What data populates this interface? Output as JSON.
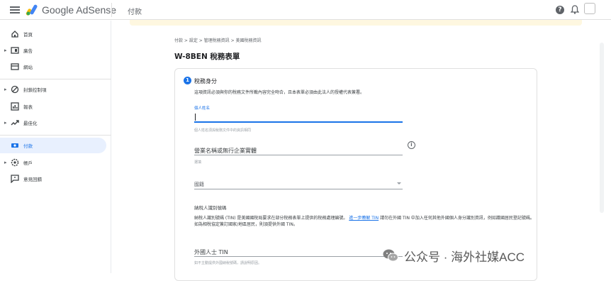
{
  "topbar": {
    "brand": "Google AdSense",
    "title": "付款"
  },
  "sidebar": {
    "items": [
      {
        "label": "首頁",
        "icon": "home-icon"
      },
      {
        "label": "廣告",
        "icon": "ads-icon"
      },
      {
        "label": "網站",
        "icon": "sites-icon"
      },
      {
        "label": "封鎖控制項",
        "icon": "block-icon"
      },
      {
        "label": "報表",
        "icon": "reports-icon"
      },
      {
        "label": "最佳化",
        "icon": "optimize-icon"
      },
      {
        "label": "付款",
        "icon": "payments-icon"
      },
      {
        "label": "帳戶",
        "icon": "account-settings-icon"
      },
      {
        "label": "意見回饋",
        "icon": "feedback-icon"
      }
    ]
  },
  "breadcrumb": "付款 > 設定 > 管理稅務資訊 > 美國稅務資訊",
  "page_title": "W-8BEN 稅務表單",
  "form": {
    "step_number": "1",
    "section_title": "稅務身分",
    "section_desc": "這項資訊必須與你的稅務文件所載內容完全吻合，且本表單必須由此法人的授權代表簽署。",
    "name_label": "個人姓名",
    "name_helper": "個人姓名須與稅務文件中的資訊相同",
    "business_label": "營業名稱或無行企業實體",
    "business_helper": "選填",
    "country_label": "國籍",
    "tin_heading": "納稅人識別號碼",
    "tin_desc_1": "納稅人識別號碼 (TIN) 是美國國稅局要求在部分稅務表單上提供的稅務處理編號。",
    "tin_link": "進一步瞭解 TIN",
    "tin_desc_2": "請勿在外國 TIN 中加入任何其他外國個人身分識別資訊，例如護國居民登記號碼。如為相稅協定簽訂國家/地區居民，則須提供外國 TIN。",
    "foreign_tin_label": "外國人士 TIN",
    "foreign_tin_helper": "如不主動提供外國納稅號碼，請說明原因。"
  },
  "watermark": "公众号 · 海外社媒ACC",
  "colors": {
    "accent": "#1a73e8",
    "banner": "#fef7e0"
  }
}
